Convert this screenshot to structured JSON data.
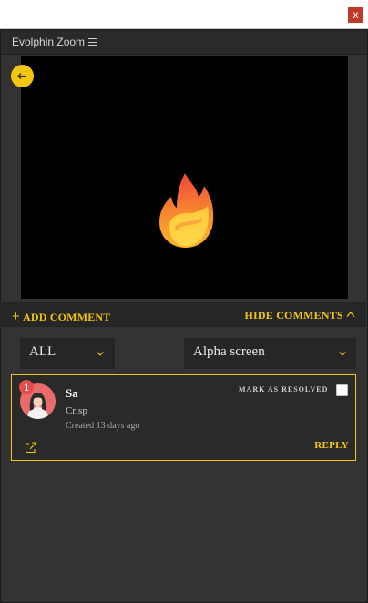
{
  "window": {
    "close_glyph": "x"
  },
  "panel": {
    "title": "Evolphin Zoom",
    "menu_icon": "hamburger-menu-icon"
  },
  "preview": {
    "back_icon": "arrow-left-icon",
    "media_icon": "fire-emoji"
  },
  "comments_bar": {
    "add_plus": "+",
    "add_label": "ADD COMMENT",
    "hide_label": "HIDE COMMENTS"
  },
  "filters": {
    "status": {
      "selected": "ALL"
    },
    "asset": {
      "selected": "Alpha screen"
    }
  },
  "comments": [
    {
      "number": "1",
      "author": "Sa",
      "text": "Crisp",
      "created": "Created 13 days ago",
      "resolve_label": "MARK AS RESOLVED",
      "resolved": false,
      "reply_label": "REPLY"
    }
  ],
  "colors": {
    "accent": "#f3c613",
    "panel_bg": "#333333",
    "bar_bg": "#262626",
    "badge": "#e54d4d"
  }
}
